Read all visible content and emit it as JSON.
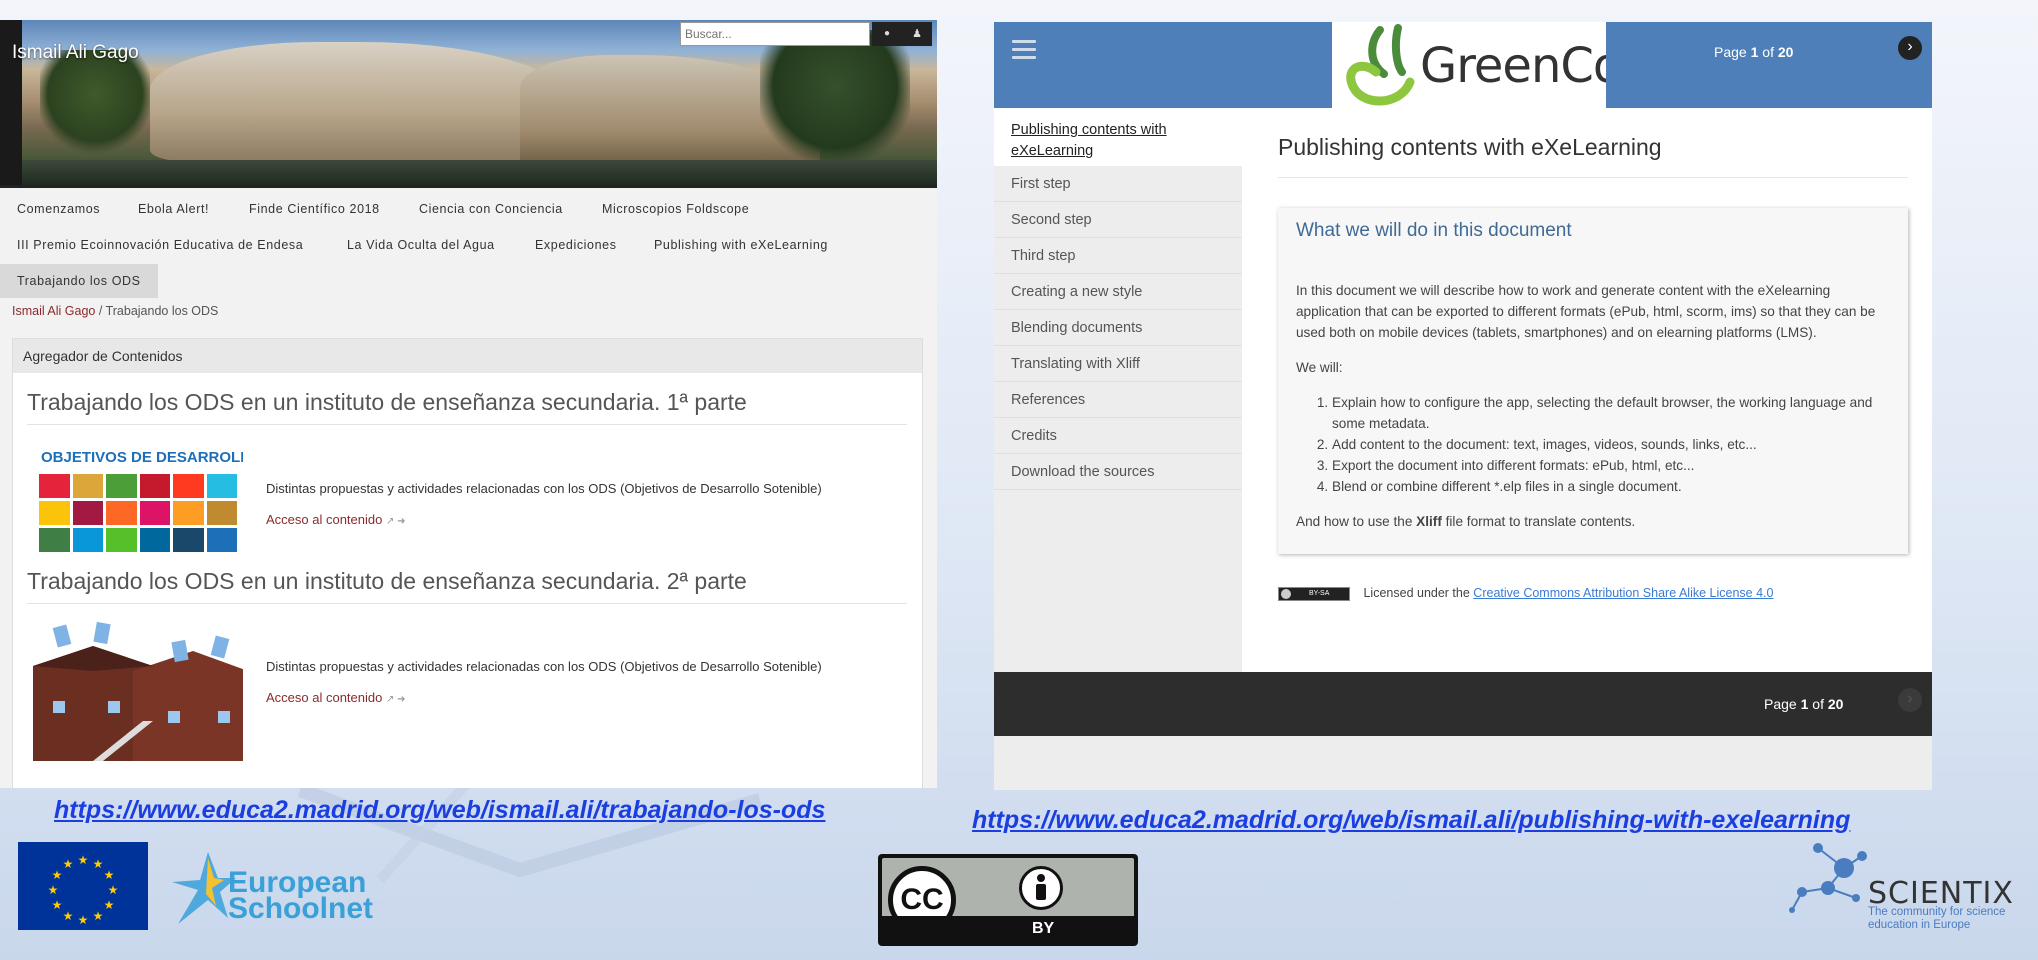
{
  "colors": {
    "accent_blue": "#4e7fb8",
    "link_red": "#8b2b2b",
    "link_blue": "#1a3ee0",
    "footer_dark": "#2d2d2d"
  },
  "left_site": {
    "title": "Ismail Ali Gago",
    "search": {
      "placeholder": "Buscar..."
    },
    "icons": [
      "search-icon",
      "user-icon"
    ],
    "nav": [
      "Comenzamos",
      "Ebola Alert!",
      "Finde Científico 2018",
      "Ciencia con Conciencia",
      "Microscopios Foldscope",
      "III Premio Ecoinnovación Educativa de Endesa",
      "La Vida Oculta del Agua",
      "Expediciones",
      "Publishing with eXeLearning",
      "Trabajando los ODS"
    ],
    "breadcrumb": {
      "home": "Ismail Ali Gago",
      "separator": "/",
      "current": "Trabajando los ODS"
    },
    "portlet_title": "Agregador de Contenidos",
    "entries": [
      {
        "title": "Trabajando los ODS en un instituto de enseñanza secundaria. 1ª parte",
        "description": "Distintas propuestas y actividades relacionadas con los ODS (Objetivos de Desarrollo Sotenible)",
        "link": "Acceso al contenido",
        "image_text": "OBJETIVOS DE DESARROLLO SOSTENIBLE"
      },
      {
        "title": "Trabajando los ODS en un instituto de enseñanza secundaria. 2ª parte",
        "description": "Distintas propuestas y actividades relacionadas con los ODS (Objetivos de Desarrollo Sotenible)",
        "link": "Acceso al contenido"
      }
    ]
  },
  "right_site": {
    "logo": "GreenCo",
    "pager": {
      "prefix": "Page ",
      "current": "1",
      "sep": " of ",
      "total": "20"
    },
    "nav_current": "Publishing contents with eXeLearning",
    "nav": [
      "First step",
      "Second step",
      "Third step",
      "Creating a new style",
      "Blending documents",
      "Translating with Xliff",
      "References",
      "Credits",
      "Download the sources"
    ],
    "page_title": "Publishing contents with eXeLearning",
    "idevice": {
      "title": "What we will do in this document",
      "intro": "In this document we will describe how to work and generate content with the eXelearning application that can be exported to different formats (ePub, html, scorm, ims) so that they can be used both on mobile devices (tablets, smartphones) and on elearning platforms (LMS).",
      "we_will": "We will:",
      "steps": [
        "Explain how to configure the app, selecting the default browser, the working language and some metadata.",
        "Add content to the document: text, images, videos, sounds, links, etc...",
        "Export the document into different formats: ePub, html, etc...",
        "Blend or combine different *.elp files in a single document."
      ],
      "outro_pre": "And how to use the ",
      "outro_bold": "Xliff",
      "outro_post": " file format to translate contents."
    },
    "license": {
      "badge": "BY-SA",
      "prefix": "Licensed under the ",
      "link": "Creative Commons Attribution Share Alike License 4.0"
    }
  },
  "bottom": {
    "link_left": "https://www.educa2.madrid.org/web/ismail.ali/trabajando-los-ods",
    "link_right": "https://www.educa2.madrid.org/web/ismail.ali/publishing-with-exelearning",
    "esn": {
      "line1": "European",
      "line2": "Schoolnet"
    },
    "cc": {
      "cc": "CC",
      "by": "BY"
    },
    "scientix": {
      "name": "SCIENTIX",
      "tagline": "The community for science education in Europe"
    }
  }
}
